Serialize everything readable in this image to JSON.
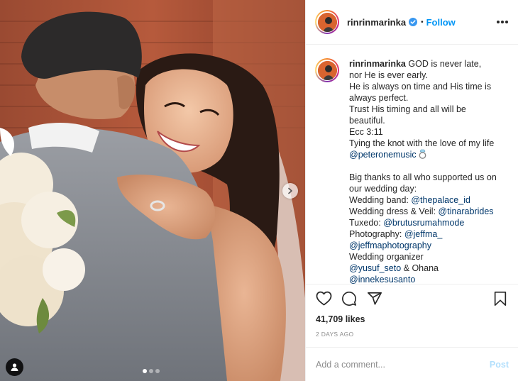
{
  "post": {
    "username": "rinrinmarinka",
    "separator": "•",
    "follow_label": "Follow",
    "caption_lines": [
      {
        "type": "first",
        "text": "GOD is never late,"
      },
      {
        "type": "text",
        "text": "nor He is ever early."
      },
      {
        "type": "text",
        "text": "He is always on time and His time is"
      },
      {
        "type": "text",
        "text": "always perfect."
      },
      {
        "type": "text",
        "text": "Trust His timing and all will be"
      },
      {
        "type": "text",
        "text": "beautiful."
      },
      {
        "type": "text",
        "text": "Ecc 3:11"
      },
      {
        "type": "text",
        "text": "Tying the knot with the love of my life"
      },
      {
        "type": "mention-emoji",
        "mention": "@peteronemusic",
        "emoji": "ring-emoji"
      },
      {
        "type": "blank",
        "text": ""
      },
      {
        "type": "text",
        "text": "Big thanks to all who supported us on"
      },
      {
        "type": "text",
        "text": "our wedding day:"
      },
      {
        "type": "label-mention",
        "label": "Wedding band: ",
        "mention": "@thepalace_id"
      },
      {
        "type": "label-mention",
        "label": "Wedding dress & Veil: ",
        "mention": "@tinarabrides"
      },
      {
        "type": "label-mention",
        "label": "Tuxedo: ",
        "mention": "@brutusrumahmode"
      },
      {
        "type": "label-mention",
        "label": "Photography: ",
        "mention": "@jeffma_"
      },
      {
        "type": "mention",
        "mention": "@jeffmaphotography"
      },
      {
        "type": "text",
        "text": "Wedding organizer"
      },
      {
        "type": "mention-text",
        "mention": "@yusuf_seto",
        "text": " & Ohana"
      },
      {
        "type": "mention",
        "mention": "@innekesusanto"
      }
    ],
    "likes": "41,709 likes",
    "time": "2 DAYS AGO",
    "comment_placeholder": "Add a comment...",
    "post_label": "Post",
    "carousel": {
      "count": 3,
      "active": 0
    },
    "icons": {
      "verified": "verified-badge-icon",
      "more": "more-options-icon",
      "like": "heart-icon",
      "comment": "comment-icon",
      "share": "share-icon",
      "save": "bookmark-icon",
      "next": "chevron-right-icon",
      "tags": "user-tag-icon",
      "ring": "ring-emoji"
    },
    "colors": {
      "link": "#00376b",
      "follow": "#0095f6",
      "verified": "#3897f0",
      "post_disabled": "#b2dffc",
      "muted": "#8e8e8e"
    }
  }
}
